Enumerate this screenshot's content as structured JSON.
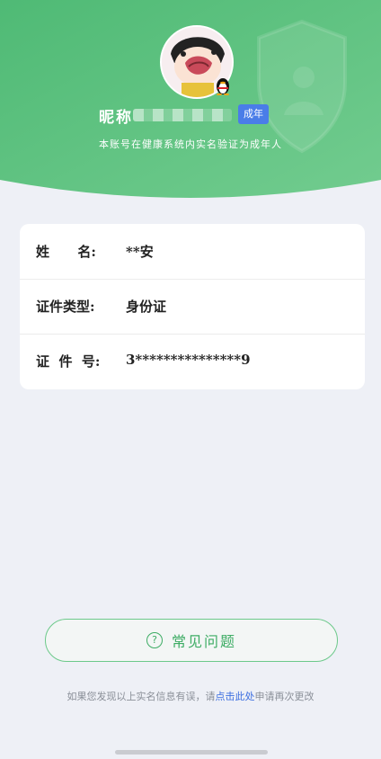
{
  "header": {
    "nickname_label": "昵称",
    "adult_badge": "成年",
    "verify_note": "本账号在健康系统内实名验证为成年人"
  },
  "info": {
    "rows": [
      {
        "label": "姓      名:",
        "value": "**安"
      },
      {
        "label": "证件类型:",
        "value": "身份证"
      },
      {
        "label": "证  件  号:",
        "value": "3***************9"
      }
    ]
  },
  "faq": {
    "label": "常见问题",
    "icon": "question-circle-icon"
  },
  "footer": {
    "prefix": "如果您发现以上实名信息有误，请",
    "link": "点击此处",
    "suffix": "申请再次更改"
  },
  "colors": {
    "header_green": "#5ec281",
    "accent_green": "#3dac64",
    "badge_blue": "#4a7de8",
    "link_blue": "#3c6ee0"
  }
}
